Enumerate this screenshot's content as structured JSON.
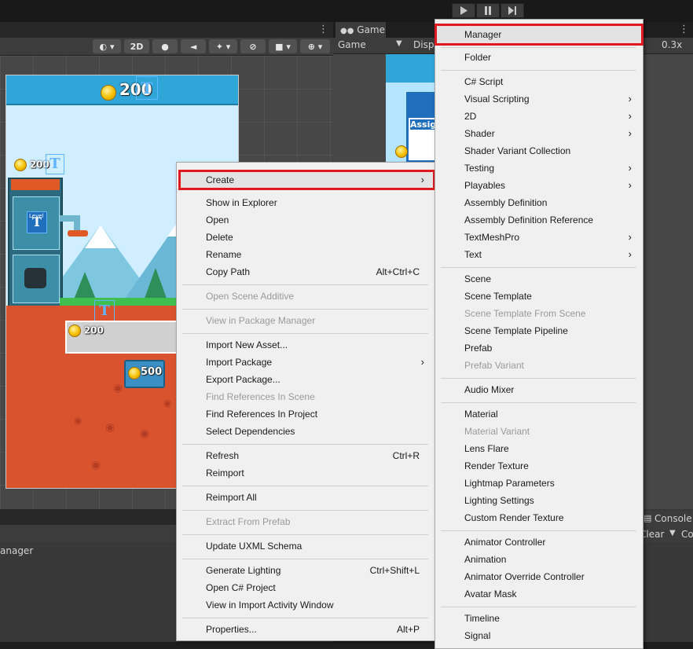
{
  "toolbar": {
    "play_icon": "play-icon",
    "pause_icon": "pause-icon",
    "step_icon": "step-icon"
  },
  "scene": {
    "mode_2d": "2D"
  },
  "game_panel": {
    "tab_label": "Game",
    "display_label": "Game",
    "display_partial": "Disp",
    "scale": "0.3x",
    "assign_partial": "Assig"
  },
  "game_preview": {
    "top_coins": "200",
    "left_coins": "200",
    "mid_coins": "200",
    "box_coins": "500",
    "level_label": "Level"
  },
  "lower_panel": {
    "title_partial": "anager"
  },
  "console": {
    "tab_label": "Console",
    "clear_label": "Clear",
    "co_partial": "Co"
  },
  "context_menu": {
    "items": [
      {
        "label": "Create",
        "shortcut": "",
        "submenu": true,
        "disabled": false
      },
      {
        "label": "Show in Explorer",
        "shortcut": "",
        "submenu": false,
        "disabled": false
      },
      {
        "label": "Open",
        "shortcut": "",
        "submenu": false,
        "disabled": false
      },
      {
        "label": "Delete",
        "shortcut": "",
        "submenu": false,
        "disabled": false
      },
      {
        "label": "Rename",
        "shortcut": "",
        "submenu": false,
        "disabled": false
      },
      {
        "label": "Copy Path",
        "shortcut": "Alt+Ctrl+C",
        "submenu": false,
        "disabled": false
      },
      {
        "label": "Open Scene Additive",
        "shortcut": "",
        "submenu": false,
        "disabled": true
      },
      {
        "label": "View in Package Manager",
        "shortcut": "",
        "submenu": false,
        "disabled": true
      },
      {
        "label": "Import New Asset...",
        "shortcut": "",
        "submenu": false,
        "disabled": false
      },
      {
        "label": "Import Package",
        "shortcut": "",
        "submenu": true,
        "disabled": false
      },
      {
        "label": "Export Package...",
        "shortcut": "",
        "submenu": false,
        "disabled": false
      },
      {
        "label": "Find References In Scene",
        "shortcut": "",
        "submenu": false,
        "disabled": true
      },
      {
        "label": "Find References In Project",
        "shortcut": "",
        "submenu": false,
        "disabled": false
      },
      {
        "label": "Select Dependencies",
        "shortcut": "",
        "submenu": false,
        "disabled": false
      },
      {
        "label": "Refresh",
        "shortcut": "Ctrl+R",
        "submenu": false,
        "disabled": false
      },
      {
        "label": "Reimport",
        "shortcut": "",
        "submenu": false,
        "disabled": false
      },
      {
        "label": "Reimport All",
        "shortcut": "",
        "submenu": false,
        "disabled": false
      },
      {
        "label": "Extract From Prefab",
        "shortcut": "",
        "submenu": false,
        "disabled": true
      },
      {
        "label": "Update UXML Schema",
        "shortcut": "",
        "submenu": false,
        "disabled": false
      },
      {
        "label": "Generate Lighting",
        "shortcut": "Ctrl+Shift+L",
        "submenu": false,
        "disabled": false
      },
      {
        "label": "Open C# Project",
        "shortcut": "",
        "submenu": false,
        "disabled": false
      },
      {
        "label": "View in Import Activity Window",
        "shortcut": "",
        "submenu": false,
        "disabled": false
      },
      {
        "label": "Properties...",
        "shortcut": "Alt+P",
        "submenu": false,
        "disabled": false
      }
    ]
  },
  "create_submenu": {
    "items": [
      {
        "label": "Manager",
        "submenu": false,
        "disabled": false
      },
      {
        "label": "Folder",
        "submenu": false,
        "disabled": false
      },
      {
        "label": "C# Script",
        "submenu": false,
        "disabled": false
      },
      {
        "label": "Visual Scripting",
        "submenu": true,
        "disabled": false
      },
      {
        "label": "2D",
        "submenu": true,
        "disabled": false
      },
      {
        "label": "Shader",
        "submenu": true,
        "disabled": false
      },
      {
        "label": "Shader Variant Collection",
        "submenu": false,
        "disabled": false
      },
      {
        "label": "Testing",
        "submenu": true,
        "disabled": false
      },
      {
        "label": "Playables",
        "submenu": true,
        "disabled": false
      },
      {
        "label": "Assembly Definition",
        "submenu": false,
        "disabled": false
      },
      {
        "label": "Assembly Definition Reference",
        "submenu": false,
        "disabled": false
      },
      {
        "label": "TextMeshPro",
        "submenu": true,
        "disabled": false
      },
      {
        "label": "Text",
        "submenu": true,
        "disabled": false
      },
      {
        "label": "Scene",
        "submenu": false,
        "disabled": false
      },
      {
        "label": "Scene Template",
        "submenu": false,
        "disabled": false
      },
      {
        "label": "Scene Template From Scene",
        "submenu": false,
        "disabled": true
      },
      {
        "label": "Scene Template Pipeline",
        "submenu": false,
        "disabled": false
      },
      {
        "label": "Prefab",
        "submenu": false,
        "disabled": false
      },
      {
        "label": "Prefab Variant",
        "submenu": false,
        "disabled": true
      },
      {
        "label": "Audio Mixer",
        "submenu": false,
        "disabled": false
      },
      {
        "label": "Material",
        "submenu": false,
        "disabled": false
      },
      {
        "label": "Material Variant",
        "submenu": false,
        "disabled": true
      },
      {
        "label": "Lens Flare",
        "submenu": false,
        "disabled": false
      },
      {
        "label": "Render Texture",
        "submenu": false,
        "disabled": false
      },
      {
        "label": "Lightmap Parameters",
        "submenu": false,
        "disabled": false
      },
      {
        "label": "Lighting Settings",
        "submenu": false,
        "disabled": false
      },
      {
        "label": "Custom Render Texture",
        "submenu": false,
        "disabled": false
      },
      {
        "label": "Animator Controller",
        "submenu": false,
        "disabled": false
      },
      {
        "label": "Animation",
        "submenu": false,
        "disabled": false
      },
      {
        "label": "Animator Override Controller",
        "submenu": false,
        "disabled": false
      },
      {
        "label": "Avatar Mask",
        "submenu": false,
        "disabled": false
      },
      {
        "label": "Timeline",
        "submenu": false,
        "disabled": false
      },
      {
        "label": "Signal",
        "submenu": false,
        "disabled": false
      }
    ]
  },
  "colors": {
    "highlight_outline": "#e0191e",
    "menu_bg": "#f0f0f0",
    "disabled_text": "#9a9a9a"
  }
}
